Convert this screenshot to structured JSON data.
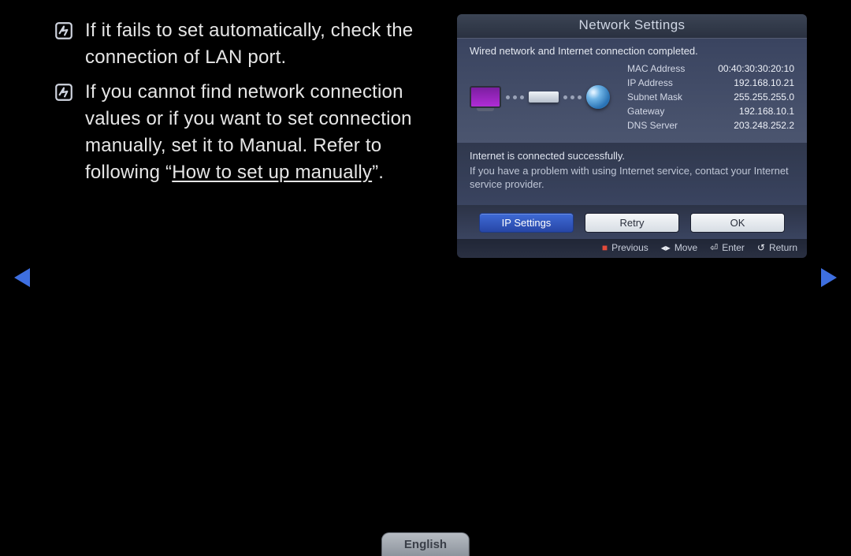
{
  "notes": {
    "line1": "If it fails to set automatically, check the connection of LAN port.",
    "line2_a": "If you cannot find network connection values or if you want to set connection manually, set it to Manual. Refer to following “",
    "line2_link": "How to set up manually",
    "line2_b": "”."
  },
  "panel": {
    "title": "Network Settings",
    "status": "Wired network and Internet connection completed.",
    "info": {
      "mac_label": "MAC Address",
      "mac_value": "00:40:30:30:20:10",
      "ip_label": "IP Address",
      "ip_value": "192.168.10.21",
      "mask_label": "Subnet Mask",
      "mask_value": "255.255.255.0",
      "gw_label": "Gateway",
      "gw_value": "192.168.10.1",
      "dns_label": "DNS Server",
      "dns_value": "203.248.252.2"
    },
    "msg1": "Internet is connected successfully.",
    "msg2": "If you have a problem with using Internet service, contact your Internet service provider.",
    "buttons": {
      "ip": "IP Settings",
      "retry": "Retry",
      "ok": "OK"
    },
    "hints": {
      "previous": "Previous",
      "move": "Move",
      "enter": "Enter",
      "return": "Return"
    }
  },
  "lang": "English"
}
